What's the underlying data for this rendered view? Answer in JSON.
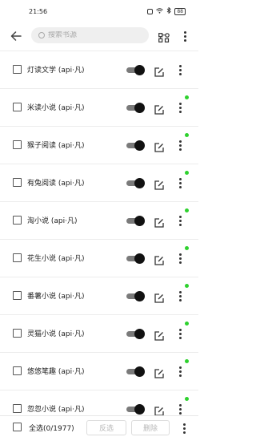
{
  "status_bar": {
    "time": "21:56",
    "battery": "88"
  },
  "toolbar": {
    "search_placeholder": "搜索书源"
  },
  "sources": [
    {
      "name": "灯读文学 (api·凡)",
      "enabled": true,
      "has_status_dot": false
    },
    {
      "name": "米读小说 (api·凡)",
      "enabled": true,
      "has_status_dot": true
    },
    {
      "name": "猴子阅读 (api·凡)",
      "enabled": true,
      "has_status_dot": true
    },
    {
      "name": "有兔阅读 (api·凡)",
      "enabled": true,
      "has_status_dot": true
    },
    {
      "name": "淘小说 (api·凡)",
      "enabled": true,
      "has_status_dot": true
    },
    {
      "name": "花生小说 (api·凡)",
      "enabled": true,
      "has_status_dot": true
    },
    {
      "name": "番薯小说 (api·凡)",
      "enabled": true,
      "has_status_dot": true
    },
    {
      "name": "灵猫小说 (api·凡)",
      "enabled": true,
      "has_status_dot": true
    },
    {
      "name": "悠悠笔趣 (api·凡)",
      "enabled": true,
      "has_status_dot": true
    },
    {
      "name": "忽忽小说 (api·凡)",
      "enabled": true,
      "has_status_dot": true
    }
  ],
  "bottom_bar": {
    "select_all_label": "全选(0/1977)",
    "invert_label": "反选",
    "delete_label": "删除"
  },
  "colors": {
    "status_dot": "#2ed12e",
    "switch_thumb": "#111111",
    "switch_track": "#7a7a7a"
  }
}
